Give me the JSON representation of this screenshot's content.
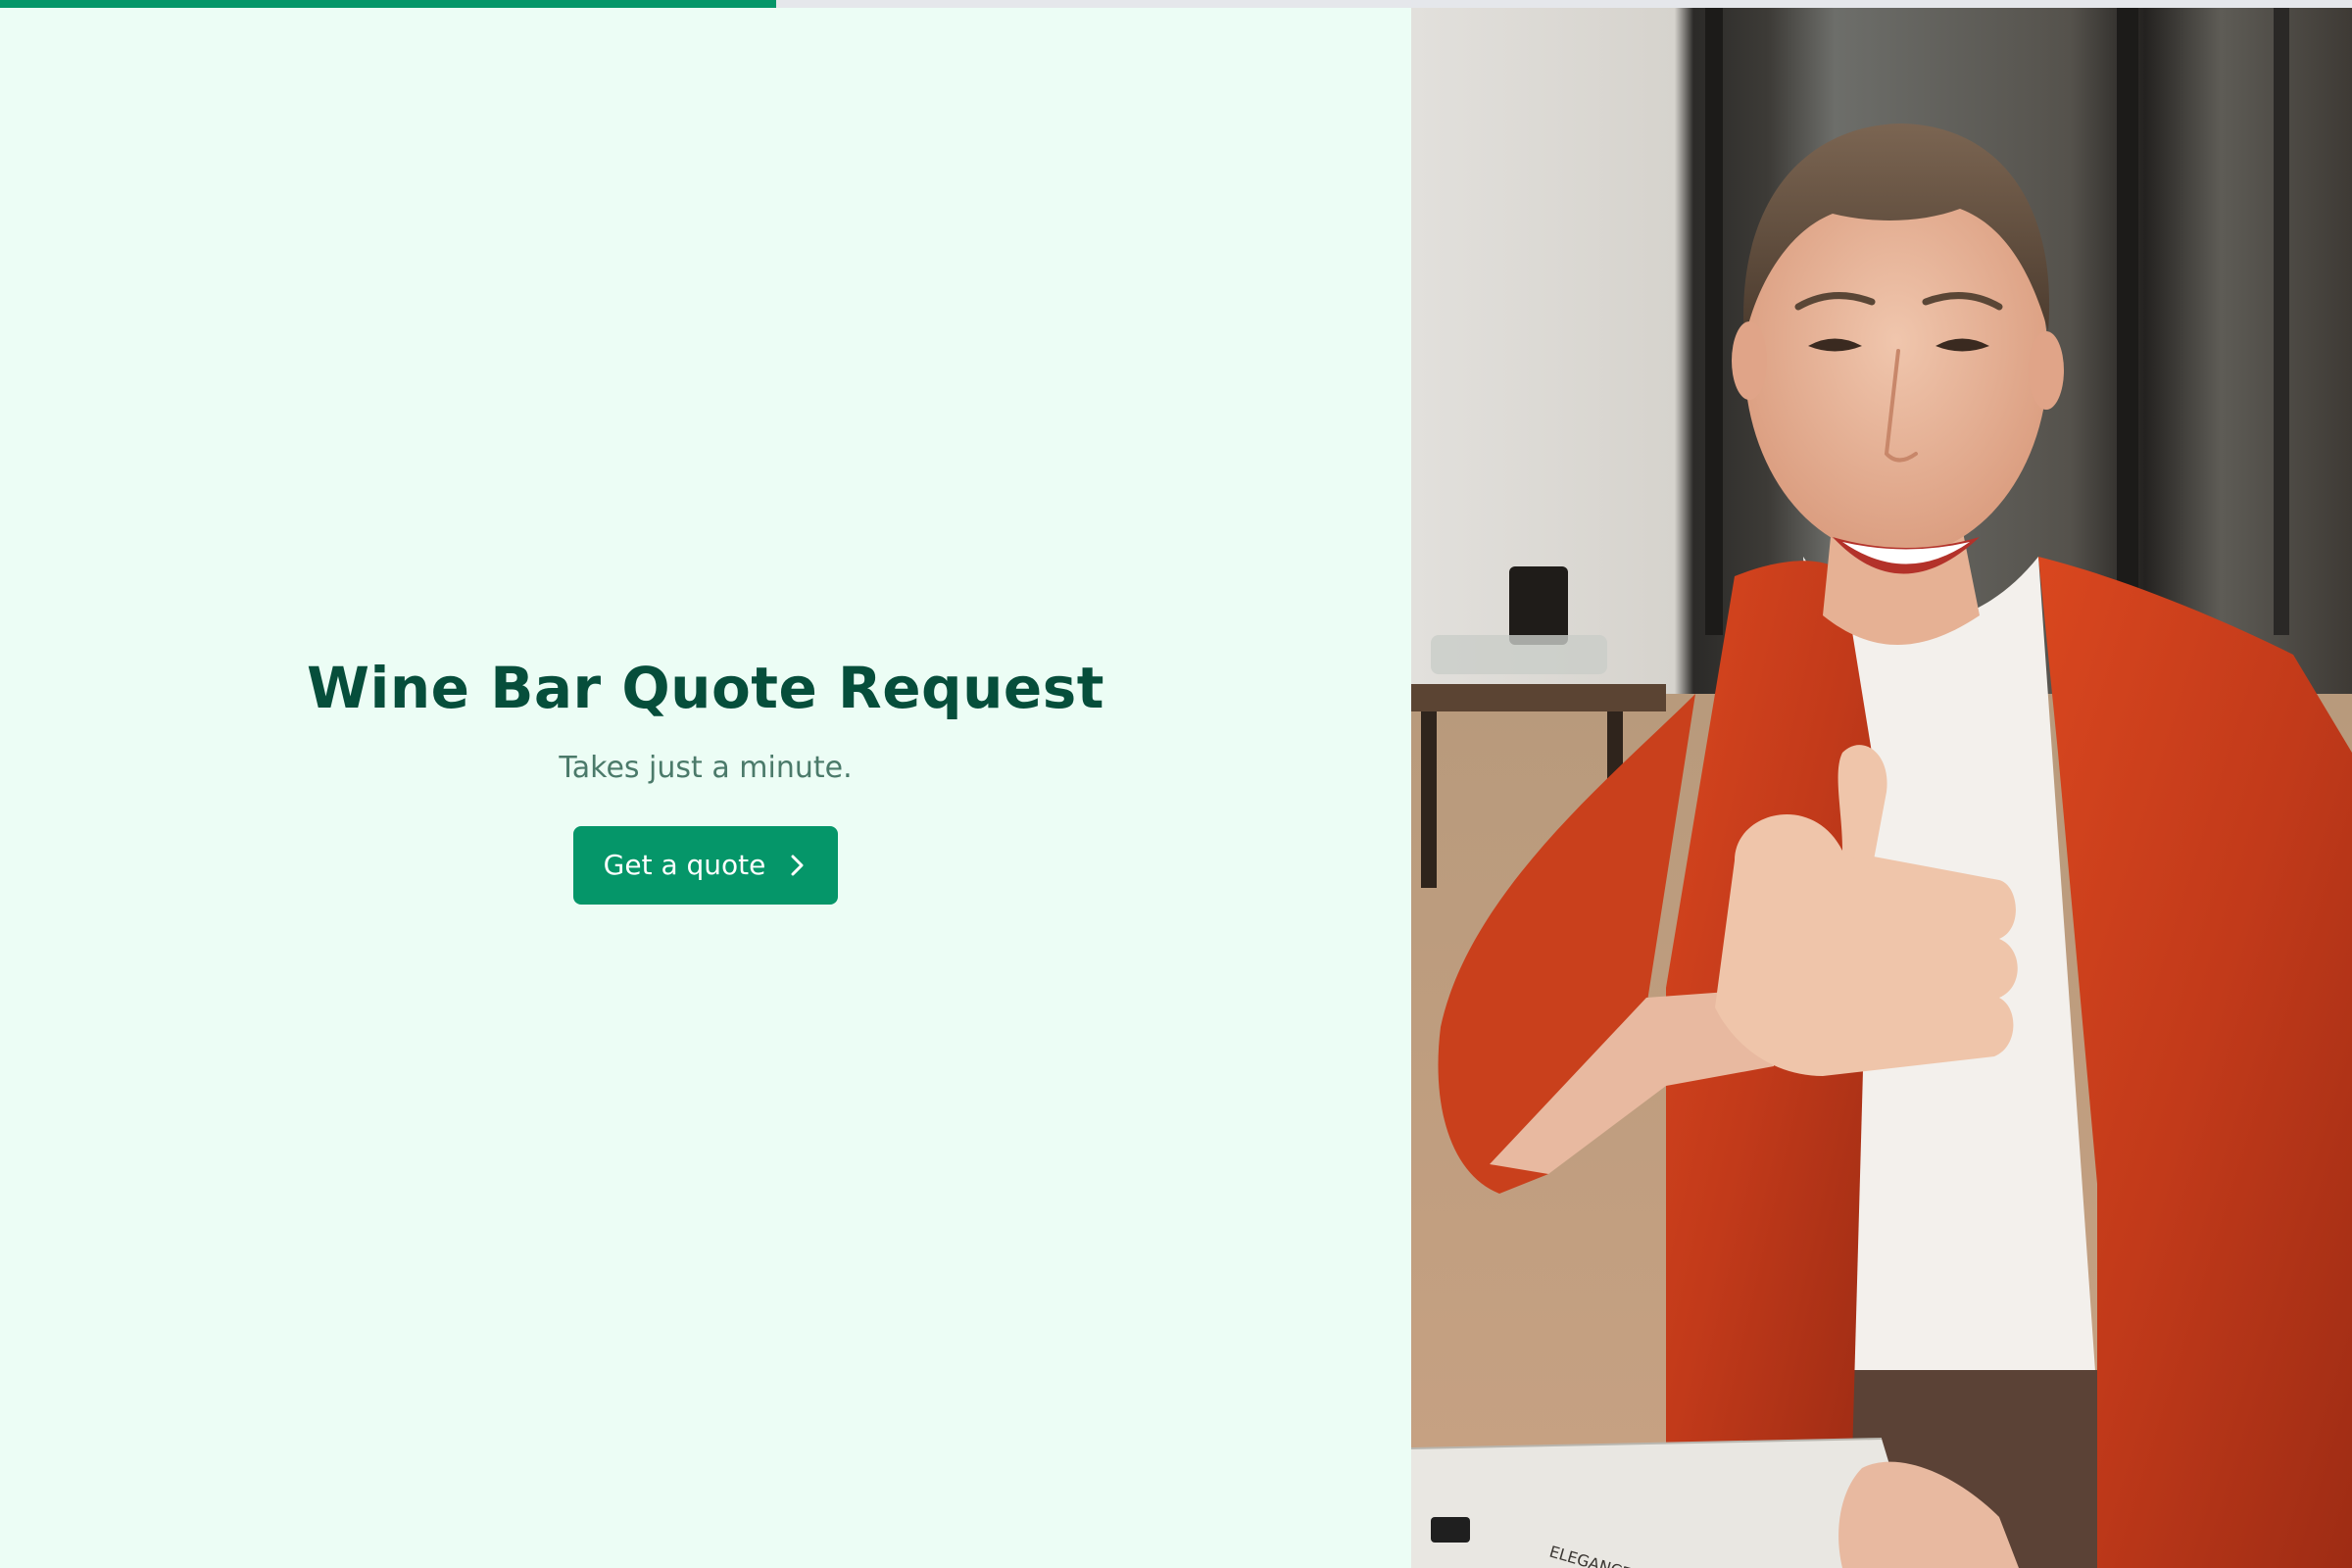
{
  "progress": {
    "fraction": 0.33
  },
  "intro": {
    "title": "Wine Bar Quote Request",
    "subtitle": "Takes just a minute.",
    "cta_label": "Get a quote",
    "cta_icon": "chevron-right-icon"
  },
  "photo": {
    "subject": "smiling woman in red blazer giving thumbs up",
    "clipboard_text": "ELEGANCE FLUIDITY"
  },
  "colors": {
    "background": "#ecfdf5",
    "accent": "#059669",
    "title": "#064e3b",
    "subtitle": "#4b7a6a",
    "progress_track": "#e5e7eb"
  }
}
